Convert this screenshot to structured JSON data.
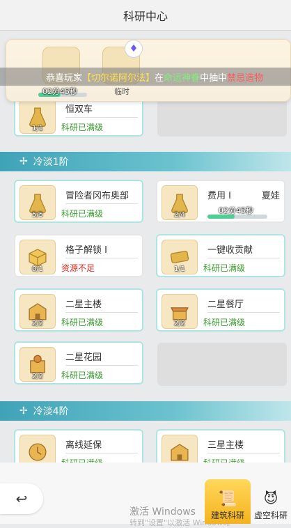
{
  "header": {
    "title": "科研中心"
  },
  "popup": {
    "item1_timer": "02分45秒",
    "item1_progress": 0.45,
    "item2_label": "临时"
  },
  "ticker": {
    "p1": "恭喜玩家",
    "p2": "【切尔诺阿尔法】",
    "p3": "在",
    "p4": "命运神眷",
    "p5": "中抽中",
    "p6": "禁忌造物"
  },
  "sections": [
    {
      "label": "冷淡1阶"
    },
    {
      "label": "冷淡4阶"
    }
  ],
  "cards": [
    {
      "name": "恒双车",
      "count": "1/1",
      "status": "科研已满级"
    },
    {
      "name": "冒险者冈布奥部",
      "count": "5/5",
      "status": "科研已满级"
    },
    {
      "name": "费用 I",
      "name2": "夏娃",
      "count": "2/4",
      "timer": "02分45秒",
      "progress": 0.45
    },
    {
      "name": "格子解锁 I",
      "count": "0/1",
      "status": "资源不足"
    },
    {
      "name": "一键收贡献",
      "count": "1/1",
      "status": "科研已满级"
    },
    {
      "name": "二星主楼",
      "count": "2/2",
      "status": "科研已满级"
    },
    {
      "name": "二星餐厅",
      "count": "2/2",
      "status": "科研已满级"
    },
    {
      "name": "二星花园",
      "count": "2/2",
      "status": "科研已满级"
    },
    {
      "name": "离线延保",
      "count": "",
      "status": "科研已满级"
    },
    {
      "name": "三星主楼",
      "count": "",
      "status": "科研已满级"
    }
  ],
  "bottom": {
    "back_icon": "back-arrow-icon",
    "tab1": "建筑科研",
    "tab2": "虚空科研",
    "watermark1": "激活 Windows",
    "watermark2": "转到\"设置\"以激活 Windows。"
  },
  "colors": {
    "accent_teal": "#aee4e1",
    "status_green": "#3aa02f",
    "status_red": "#e0291c",
    "tab_active": "#f5b21d"
  }
}
